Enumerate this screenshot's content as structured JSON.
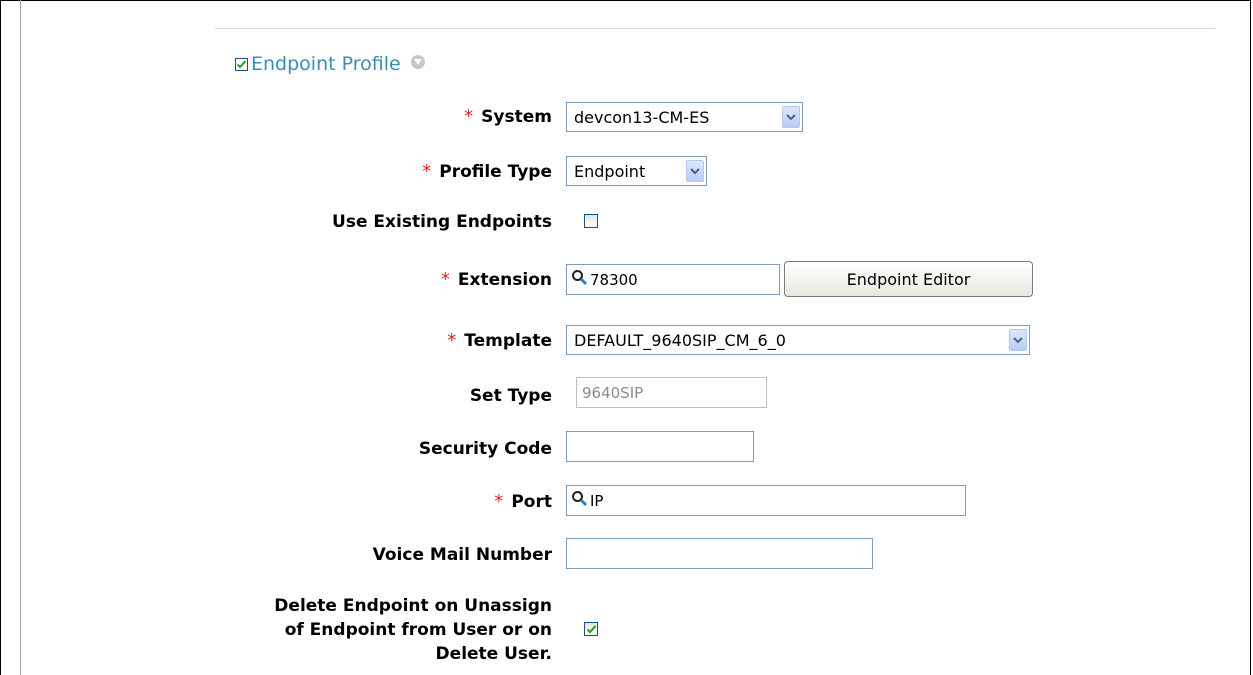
{
  "section": {
    "title": "Endpoint Profile",
    "checked": true,
    "toggle_icon": "collapse-arrow-icon"
  },
  "fields": {
    "system": {
      "label": "System",
      "value": "devcon13-CM-ES",
      "required": true
    },
    "profile_type": {
      "label": "Profile Type",
      "value": "Endpoint",
      "required": true
    },
    "use_existing": {
      "label": "Use Existing Endpoints",
      "checked": false
    },
    "extension": {
      "label": "Extension",
      "value": "78300",
      "required": true,
      "icon": "search-icon"
    },
    "endpoint_editor": {
      "label": "Endpoint Editor"
    },
    "template": {
      "label": "Template",
      "value": "DEFAULT_9640SIP_CM_6_0",
      "required": true
    },
    "set_type": {
      "label": "Set Type",
      "value": "9640SIP",
      "disabled": true
    },
    "security_code": {
      "label": "Security Code",
      "value": ""
    },
    "port": {
      "label": "Port",
      "value": "IP",
      "required": true,
      "icon": "search-icon"
    },
    "voice_mail": {
      "label": "Voice Mail Number",
      "value": ""
    },
    "delete_endpoint": {
      "label_lines": [
        "Delete Endpoint on Unassign",
        "of Endpoint from User or on",
        "Delete User."
      ],
      "checked": true
    }
  },
  "required_marker": "*",
  "colors": {
    "section_title": "#3a8fb0",
    "required": "#e02020",
    "field_border": "#7f9db9"
  }
}
